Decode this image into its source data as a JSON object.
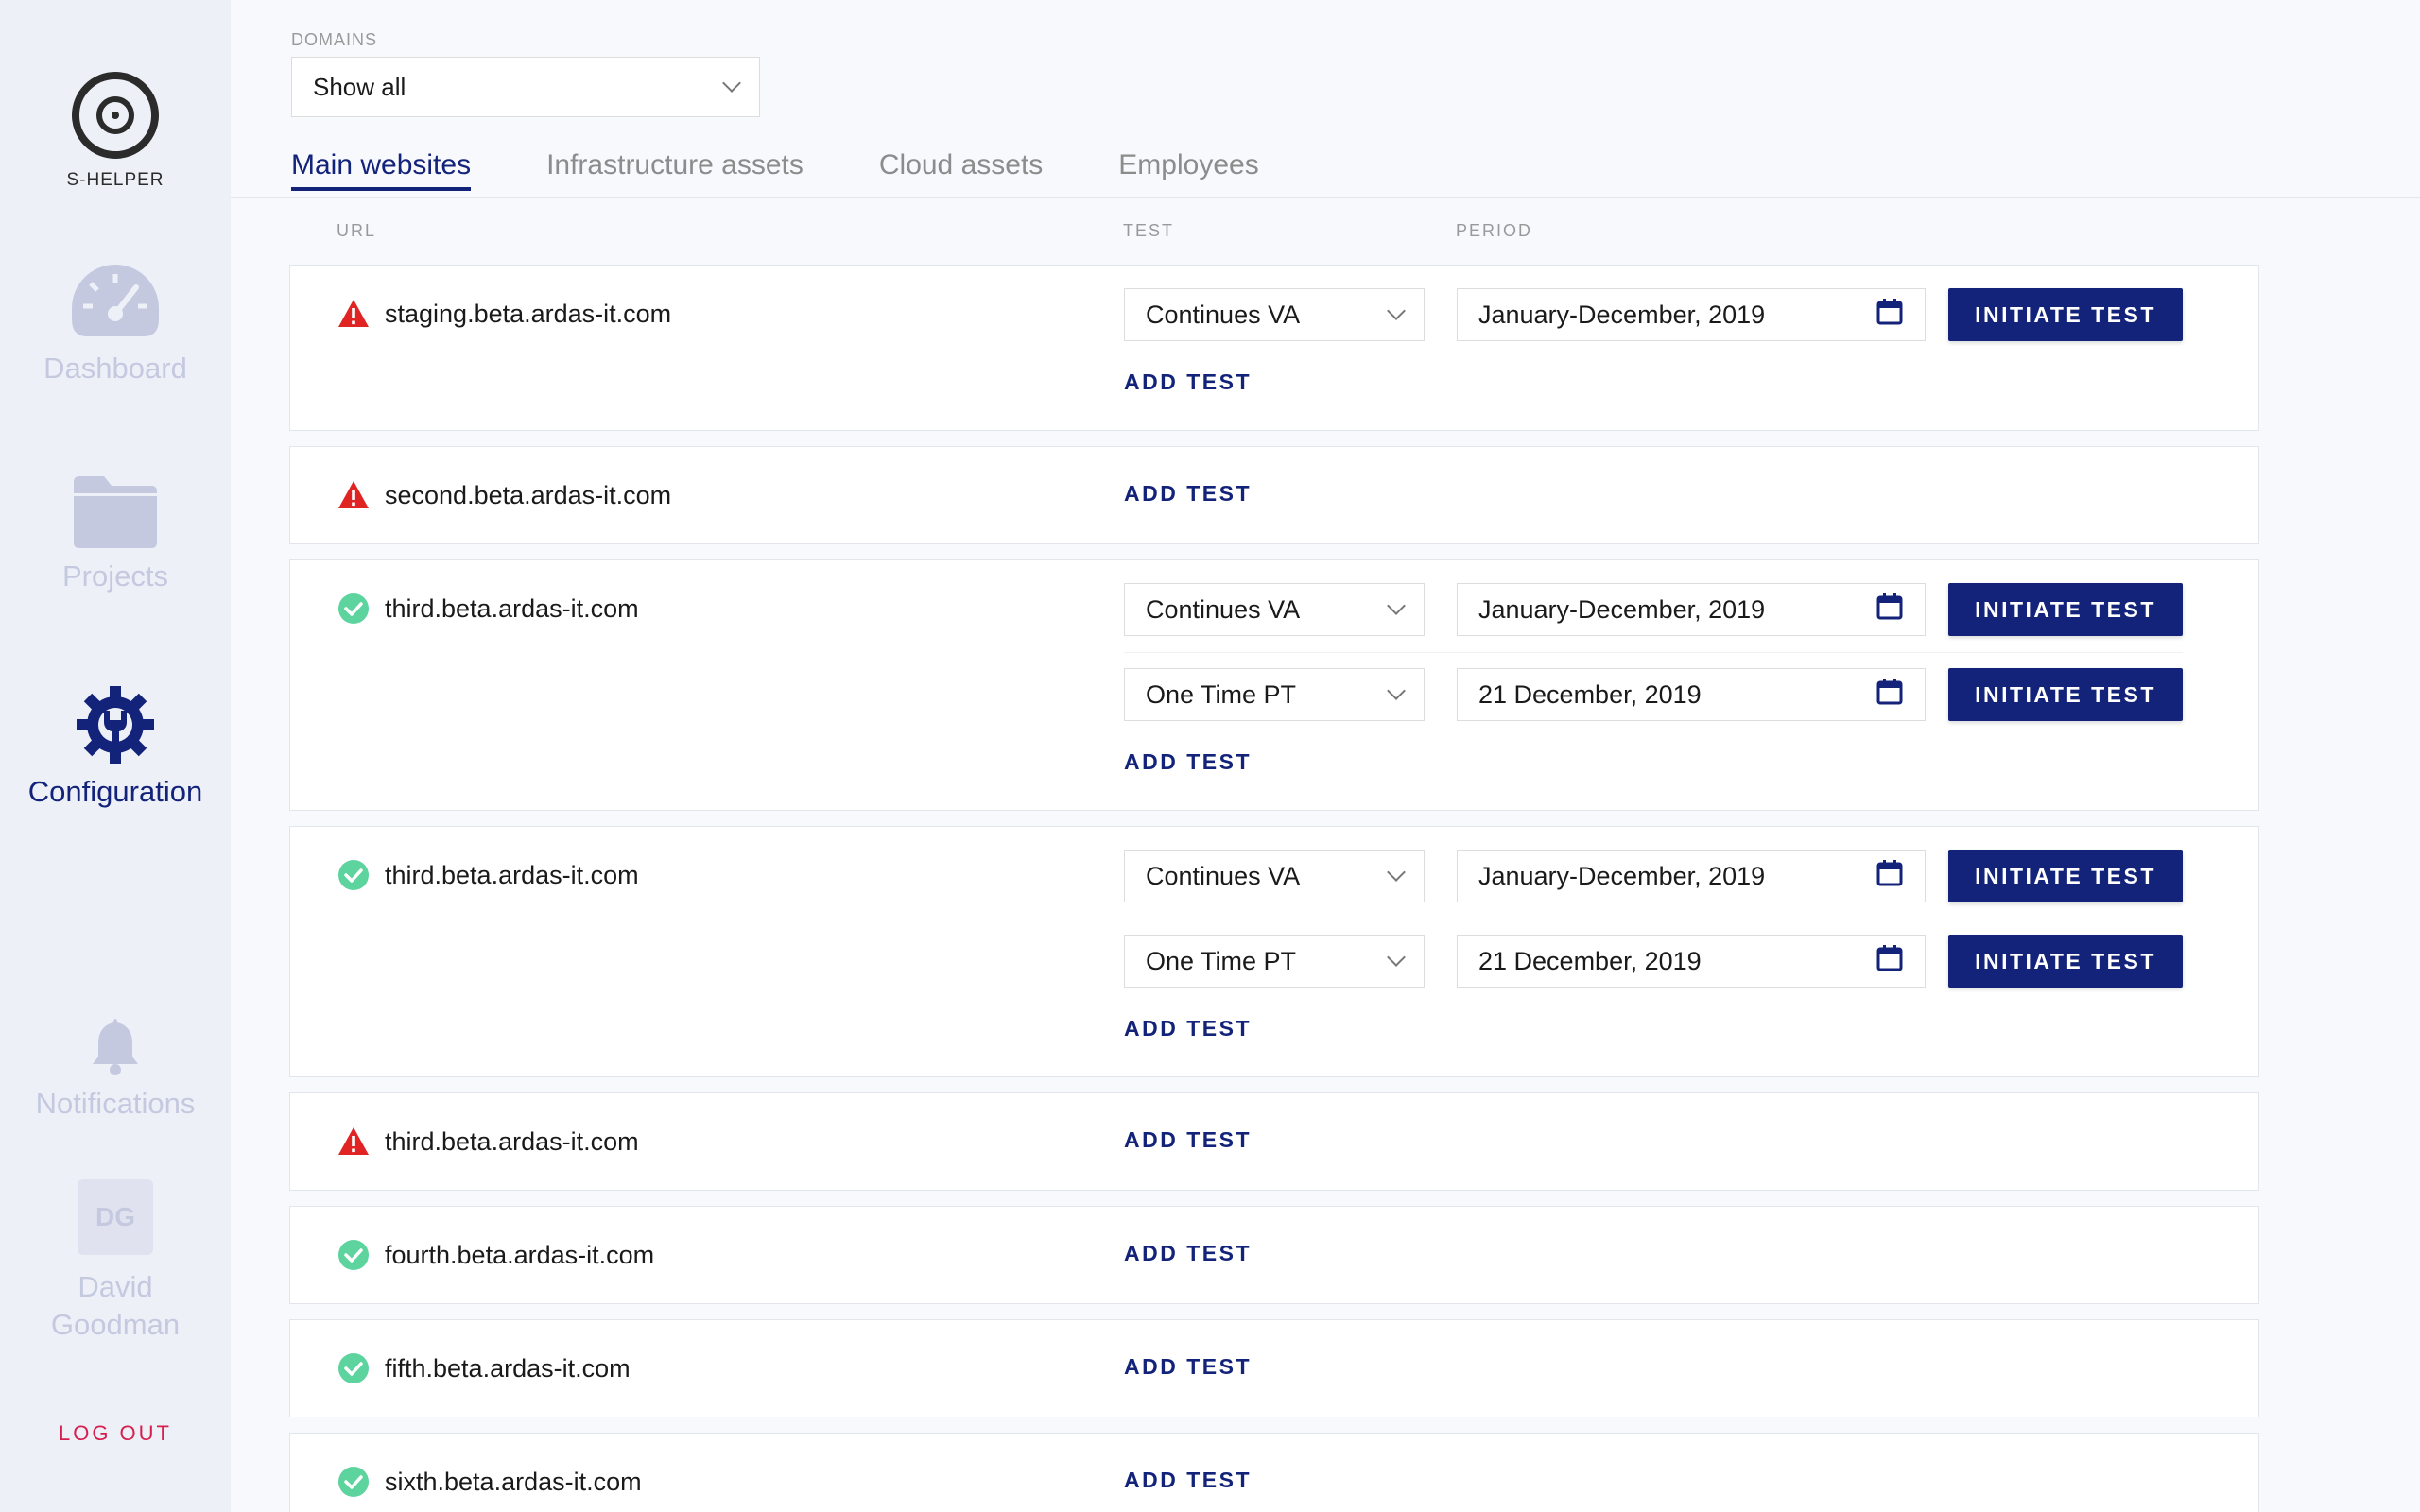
{
  "brand": {
    "name": "S-HELPER"
  },
  "nav": {
    "dashboard": "Dashboard",
    "projects": "Projects",
    "configuration": "Configuration",
    "notifications": "Notifications"
  },
  "user": {
    "initials": "DG",
    "first_name": "David",
    "last_name": "Goodman"
  },
  "logout": "LOG OUT",
  "domains": {
    "label": "DOMAINS",
    "selected": "Show all"
  },
  "tabs": [
    "Main websites",
    "Infrastructure assets",
    "Cloud assets",
    "Employees"
  ],
  "columns": {
    "url": "URL",
    "test": "TEST",
    "period": "PERIOD"
  },
  "labels": {
    "add_test": "ADD TEST",
    "initiate_test": "INITIATE TEST"
  },
  "rows": [
    {
      "url": "staging.beta.ardas-it.com",
      "status": "warning",
      "tests": [
        {
          "type": "Continues VA",
          "period": "January-December, 2019"
        }
      ]
    },
    {
      "url": "second.beta.ardas-it.com",
      "status": "warning",
      "tests": []
    },
    {
      "url": "third.beta.ardas-it.com",
      "status": "ok",
      "tests": [
        {
          "type": "Continues VA",
          "period": "January-December, 2019"
        },
        {
          "type": "One Time PT",
          "period": "21 December, 2019"
        }
      ]
    },
    {
      "url": "third.beta.ardas-it.com",
      "status": "ok",
      "tests": [
        {
          "type": "Continues VA",
          "period": "January-December, 2019"
        },
        {
          "type": "One Time PT",
          "period": "21 December, 2019"
        }
      ]
    },
    {
      "url": "third.beta.ardas-it.com",
      "status": "warning",
      "tests": []
    },
    {
      "url": "fourth.beta.ardas-it.com",
      "status": "ok",
      "tests": []
    },
    {
      "url": "fifth.beta.ardas-it.com",
      "status": "ok",
      "tests": []
    },
    {
      "url": "sixth.beta.ardas-it.com",
      "status": "ok",
      "tests": []
    }
  ],
  "colors": {
    "accent": "#13237a",
    "warning": "#e02424",
    "ok": "#5dd39e",
    "logout": "#d51f4d"
  }
}
